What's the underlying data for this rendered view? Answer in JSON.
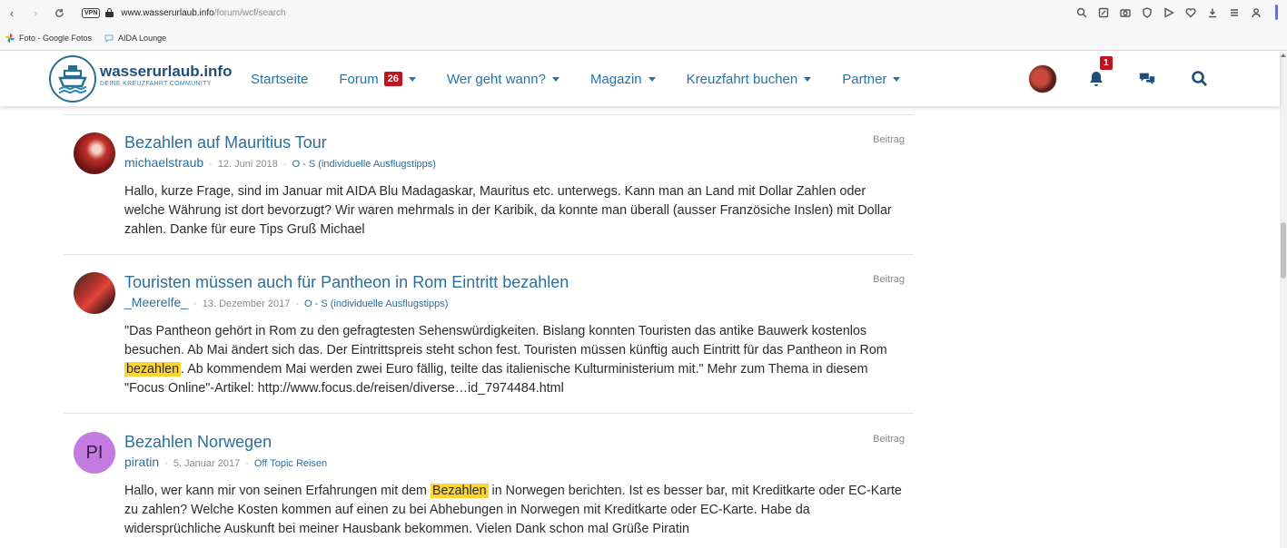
{
  "browser": {
    "vpn_label": "VPN",
    "url_domain": "www.wasserurlaub.info",
    "url_path": "/forum/wcf/search",
    "bookmarks": [
      {
        "label": "Foto - Google Fotos"
      },
      {
        "label": "AIDA Lounge"
      }
    ]
  },
  "site": {
    "brand_name": "wasserurlaub.info",
    "brand_sub": "DEINE KREUZFAHRT COMMUNITY",
    "nav": [
      {
        "label": "Startseite"
      },
      {
        "label": "Forum",
        "badge": "26"
      },
      {
        "label": "Wer geht wann?"
      },
      {
        "label": "Magazin"
      },
      {
        "label": "Kreuzfahrt buchen"
      },
      {
        "label": "Partner"
      }
    ],
    "notification_count": "1"
  },
  "results": [
    {
      "title": "Bezahlen auf Mauritius Tour",
      "type": "Beitrag",
      "user": "michaelstraub",
      "date": "12. Juni 2018",
      "forum": "O - S (individuelle Ausflugstipps)",
      "snippet_parts": [
        "Hallo, kurze Frage, sind im Januar mit AIDA Blu Madagaskar, Mauritus etc. unterwegs. Kann man an Land mit Dollar Zahlen oder welche Währung ist dort bevorzugt? Wir waren mehrmals in der Karibik, da konnte man überall (ausser Französiche Inslen) mit Dollar zahlen. Danke für eure Tips Gruß Michael"
      ]
    },
    {
      "title": "Touristen müssen auch für Pantheon in Rom Eintritt bezahlen",
      "type": "Beitrag",
      "user": "_Meerelfe_",
      "date": "13. Dezember 2017",
      "forum": "O - S (individuelle Ausflugstipps)",
      "snippet_parts": [
        "\"Das Pantheon gehört in Rom zu den gefragtesten Sehenswürdigkeiten. Bislang konnten Touristen das antike Bauwerk kostenlos besuchen. Ab Mai ändert sich das. Der Eintrittspreis steht schon fest. Touristen müssen künftig auch Eintritt für das Pantheon in Rom ",
        "bezahlen",
        ". Ab kommendem Mai werden zwei Euro fällig, teilte das italienische Kulturministerium mit.\" Mehr zum Thema in diesem \"Focus Online\"-Artikel: http://www.focus.de/reisen/diverse…id_7974484.html"
      ]
    },
    {
      "title": "Bezahlen Norwegen",
      "type": "Beitrag",
      "avatar_initials": "PI",
      "user": "piratin",
      "date": "5. Januar 2017",
      "forum": "Off Topic Reisen",
      "snippet_parts": [
        "Hallo, wer kann mir von seinen Erfahrungen mit dem ",
        "Bezahlen",
        " in Norwegen berichten. Ist es besser bar, mit Kreditkarte oder EC-Karte zu zahlen? Welche Kosten kommen auf einen zu bei Abhebungen in Norwegen mit Kreditkarte oder EC-Karte. Habe da widersprüchliche Auskunft bei meiner Hausbank bekommen. Vielen Dank schon mal Grüße Piratin"
      ]
    }
  ],
  "colors": {
    "link": "#2a6f9e",
    "highlight": "#fcd434",
    "badge": "#c0141e",
    "brand": "#1f4e79"
  }
}
